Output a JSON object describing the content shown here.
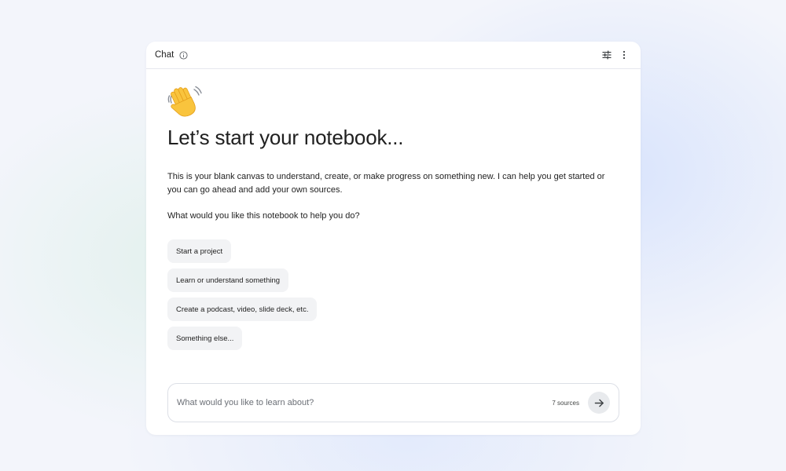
{
  "header": {
    "title": "Chat",
    "info_icon": "info-icon",
    "settings_icon": "tune-icon",
    "menu_icon": "more-vert-icon"
  },
  "main": {
    "emoji": "waving-hand-emoji",
    "heading": "Let’s start your notebook...",
    "intro": "This is your blank canvas to understand, create, or make progress on something new. I can help you get started or you can go ahead and add your own sources.",
    "question": "What would you like this notebook to help you do?",
    "suggestions": [
      "Start a project",
      "Learn or understand something",
      "Create a podcast, video, slide deck, etc.",
      "Something else..."
    ]
  },
  "composer": {
    "placeholder": "What would you like to learn about?",
    "sources_label": "7 sources",
    "send_icon": "arrow-right-icon"
  },
  "colors": {
    "card_background": "#ffffff",
    "page_background": "#f3f5fb",
    "chip_background": "#f2f3f5",
    "send_button_background": "#e8eaed"
  }
}
